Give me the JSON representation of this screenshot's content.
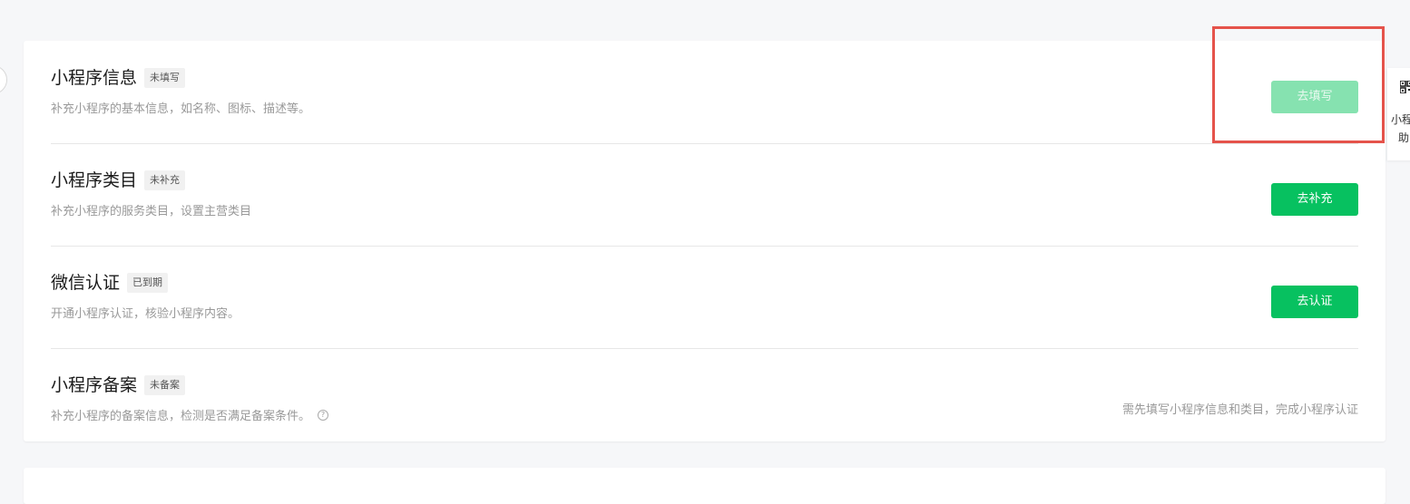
{
  "rows": [
    {
      "title": "小程序信息",
      "badge": "未填写",
      "desc": "补充小程序的基本信息，如名称、图标、描述等。",
      "button_label": "去填写",
      "button_state": "disabled"
    },
    {
      "title": "小程序类目",
      "badge": "未补充",
      "desc": "补充小程序的服务类目，设置主营类目",
      "button_label": "去补充",
      "button_state": "enabled"
    },
    {
      "title": "微信认证",
      "badge": "已到期",
      "desc": "开通小程序认证，核验小程序内容。",
      "button_label": "去认证",
      "button_state": "enabled"
    },
    {
      "title": "小程序备案",
      "badge": "未备案",
      "desc": "补充小程序的备案信息，检测是否满足备案条件。",
      "hint": "需先填写小程序信息和类目，完成小程序认证",
      "help_icon": "question-circle-icon"
    }
  ],
  "side_widget": {
    "icon": "qr-code-icon",
    "label_line1": "小程",
    "label_line2": "助"
  },
  "colors": {
    "primary_green": "#07c160",
    "disabled_green": "#86e2b0",
    "highlight_red": "#e5534b"
  }
}
